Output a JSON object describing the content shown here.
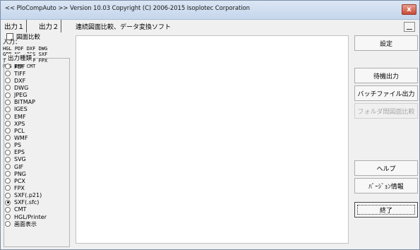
{
  "window": {
    "title": "<< PloCompAuto >>  Version 10.03 Copyright (C) 2006-2015 Isoplotec Corporation",
    "close_glyph": "x"
  },
  "tabs": [
    {
      "label": "出力１"
    },
    {
      "label": "出力２"
    }
  ],
  "heading": "連続図面比較、データ変換ソフト",
  "compare_checkbox": {
    "label": "図面比較",
    "checked": false
  },
  "input": {
    "label": "入力：",
    "formats": "HGL PDF DXF DWG\nGBR NC  IGS SXF\nTIF JPG BMP FPX\nPNG EMF CMT"
  },
  "output_types": {
    "title": "出力種類",
    "options": [
      {
        "label": "PDF",
        "checked": false
      },
      {
        "label": "TIFF",
        "checked": false
      },
      {
        "label": "DXF",
        "checked": false
      },
      {
        "label": "DWG",
        "checked": false
      },
      {
        "label": "JPEG",
        "checked": false
      },
      {
        "label": "BITMAP",
        "checked": false
      },
      {
        "label": "IGES",
        "checked": false
      },
      {
        "label": "EMF",
        "checked": false
      },
      {
        "label": "XPS",
        "checked": false
      },
      {
        "label": "PCL",
        "checked": false
      },
      {
        "label": "WMF",
        "checked": false
      },
      {
        "label": "PS",
        "checked": false
      },
      {
        "label": "EPS",
        "checked": false
      },
      {
        "label": "SVG",
        "checked": false
      },
      {
        "label": "GIF",
        "checked": false
      },
      {
        "label": "PNG",
        "checked": false
      },
      {
        "label": "PCX",
        "checked": false
      },
      {
        "label": "FPX",
        "checked": false
      },
      {
        "label": "SXF(.p21)",
        "checked": false
      },
      {
        "label": "SXF(.sfc)",
        "checked": true
      },
      {
        "label": "CMT",
        "checked": false
      },
      {
        "label": "HGL/Printer",
        "checked": false
      },
      {
        "label": "画面表示",
        "checked": false
      }
    ]
  },
  "buttons": {
    "settings": "設定",
    "standby_output": "待機出力",
    "batch_file_output": "バッチファイル出力",
    "folder_compare": "フォルダ間図面比較",
    "help": "ヘルプ",
    "version_info": "ﾊﾞｰｼﾞｮﾝ情報",
    "exit": "終了"
  },
  "colors": {
    "close_button": "#c74b36",
    "titlebar": "#c5d6ec"
  }
}
